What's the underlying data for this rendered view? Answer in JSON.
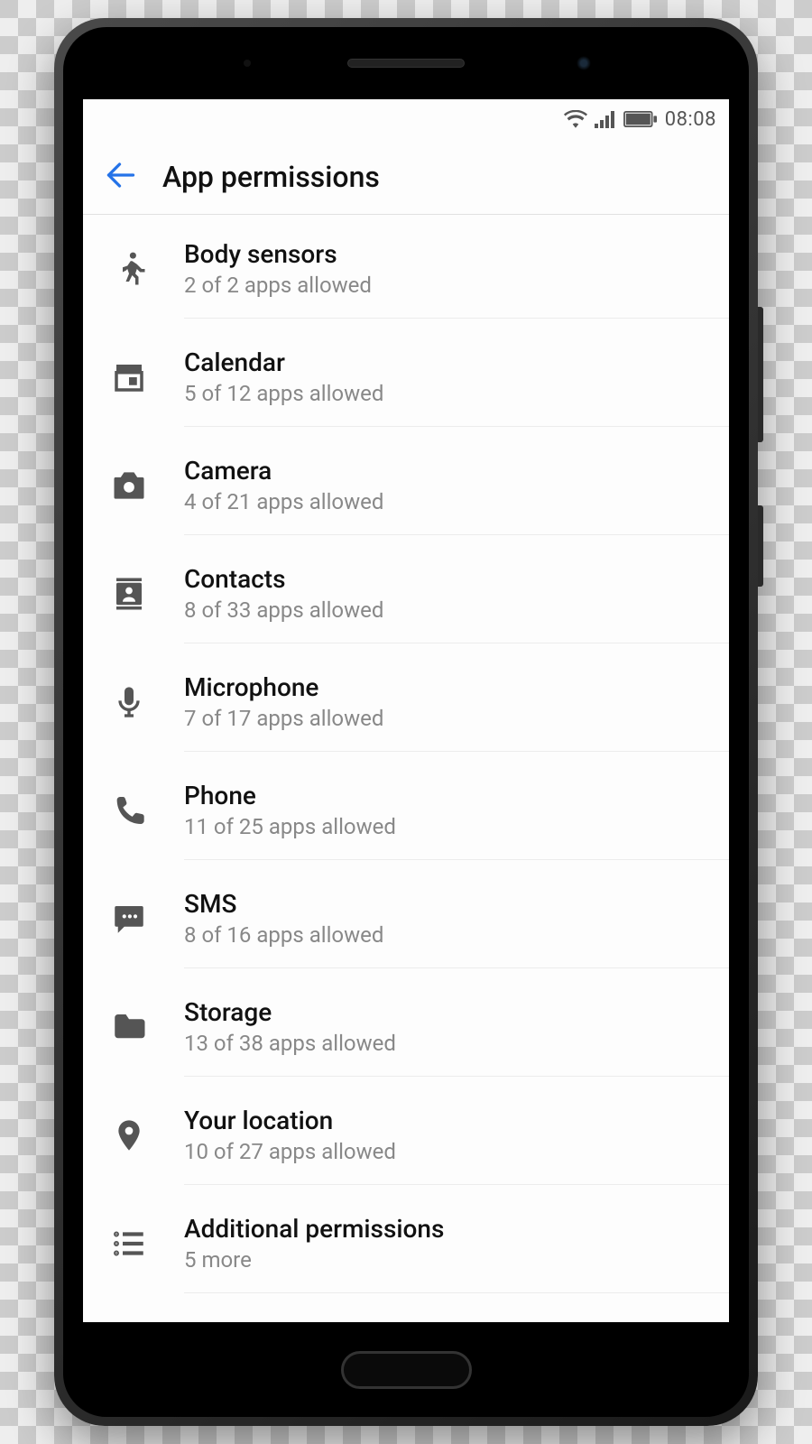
{
  "statusbar": {
    "time": "08:08"
  },
  "header": {
    "title": "App permissions"
  },
  "permissions": [
    {
      "icon": "running-icon",
      "title": "Body sensors",
      "sub": "2 of 2 apps allowed"
    },
    {
      "icon": "calendar-icon",
      "title": "Calendar",
      "sub": "5 of 12 apps allowed"
    },
    {
      "icon": "camera-icon",
      "title": "Camera",
      "sub": "4 of 21 apps allowed"
    },
    {
      "icon": "contacts-icon",
      "title": "Contacts",
      "sub": "8 of 33 apps allowed"
    },
    {
      "icon": "mic-icon",
      "title": "Microphone",
      "sub": "7 of 17 apps allowed"
    },
    {
      "icon": "phone-icon",
      "title": "Phone",
      "sub": "11 of 25 apps allowed"
    },
    {
      "icon": "sms-icon",
      "title": "SMS",
      "sub": "8 of 16 apps allowed"
    },
    {
      "icon": "storage-icon",
      "title": "Storage",
      "sub": "13 of 38 apps allowed"
    },
    {
      "icon": "location-icon",
      "title": "Your location",
      "sub": "10 of 27 apps allowed"
    },
    {
      "icon": "list-icon",
      "title": "Additional permissions",
      "sub": "5 more"
    }
  ]
}
